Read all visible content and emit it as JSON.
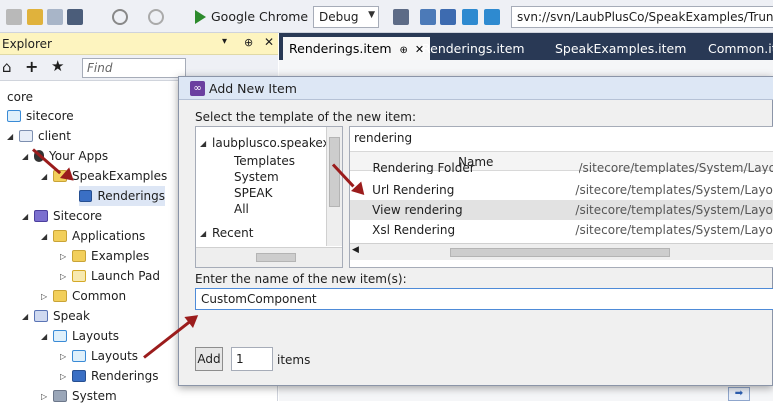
{
  "toolbar": {
    "browser_label": "Google Chrome",
    "config_value": "Debug",
    "svn_path": "svn://svn/LaubPlusCo/SpeakExamples/Trunk"
  },
  "explorer": {
    "title": "Explorer",
    "find_placeholder": "Find",
    "tree": [
      {
        "label": "core"
      },
      {
        "label": "sitecore"
      },
      {
        "label": "client"
      },
      {
        "label": "Your Apps"
      },
      {
        "label": "SpeakExamples"
      },
      {
        "label": "Renderings"
      },
      {
        "label": "Sitecore"
      },
      {
        "label": "Applications"
      },
      {
        "label": "Examples"
      },
      {
        "label": "Launch Pad"
      },
      {
        "label": "Common"
      },
      {
        "label": "Speak"
      },
      {
        "label": "Layouts"
      },
      {
        "label": "Layouts"
      },
      {
        "label": "Renderings"
      },
      {
        "label": "System"
      }
    ]
  },
  "tabs": [
    {
      "label": "Renderings.item"
    },
    {
      "label": "Renderings.item"
    },
    {
      "label": "SpeakExamples.item"
    },
    {
      "label": "Common.ite"
    }
  ],
  "dialog": {
    "title": "Add New Item",
    "template_prompt": "Select the template of the new item:",
    "template_tree": [
      {
        "label": "laubplusco.speakexa"
      },
      {
        "label": "Templates"
      },
      {
        "label": "System"
      },
      {
        "label": "SPEAK"
      },
      {
        "label": "All"
      },
      {
        "label": "Recent"
      }
    ],
    "search_value": "rendering",
    "column_name": "Name",
    "results": [
      {
        "name": "Rendering Folder",
        "path": "/sitecore/templates/System/Layout"
      },
      {
        "name": "Url Rendering",
        "path": "/sitecore/templates/System/Layouts"
      },
      {
        "name": "View rendering",
        "path": "/sitecore/templates/System/Layouts"
      },
      {
        "name": "Xsl Rendering",
        "path": "/sitecore/templates/System/Layouts"
      }
    ],
    "name_prompt": "Enter the name of the new item(s):",
    "name_value": "CustomComponent",
    "add_label": "Add",
    "count_value": "1",
    "items_label": "items"
  }
}
